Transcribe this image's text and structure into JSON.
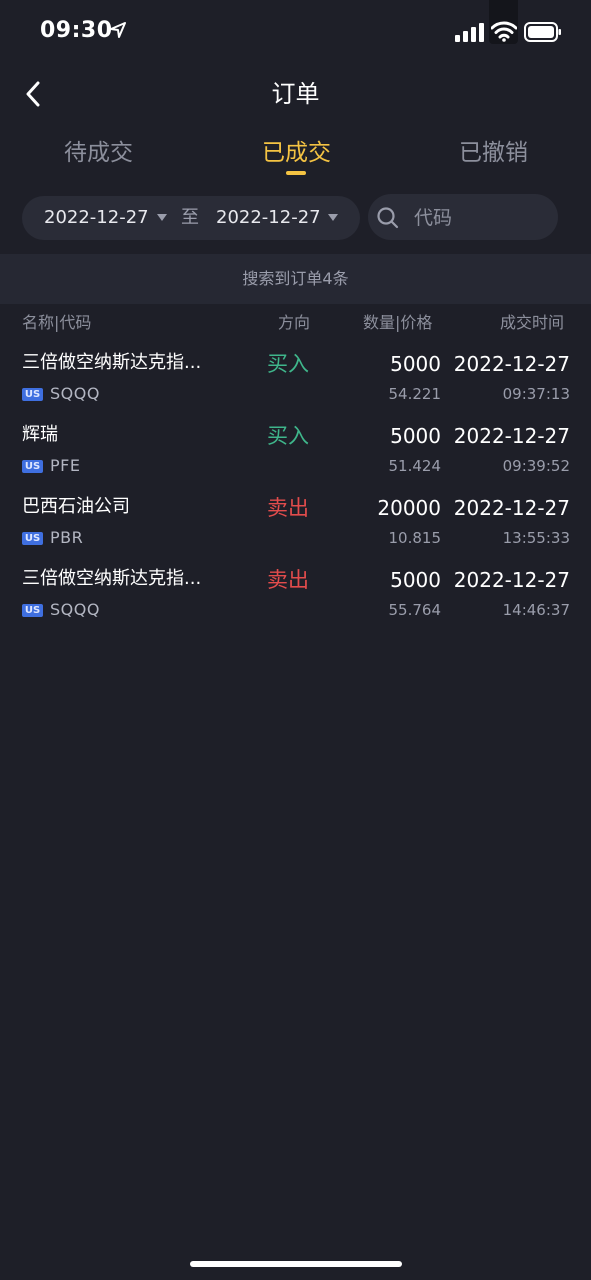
{
  "status_bar": {
    "time": "09:30",
    "icons": [
      "location-arrow-icon",
      "signal-icon",
      "wifi-icon",
      "battery-icon"
    ]
  },
  "header": {
    "title": "订单",
    "back_icon": "chevron-left-icon"
  },
  "tabs": [
    {
      "label": "待成交",
      "active": false
    },
    {
      "label": "已成交",
      "active": true
    },
    {
      "label": "已撤销",
      "active": false
    }
  ],
  "filter": {
    "start_date": "2022-12-27",
    "separator": "至",
    "end_date": "2022-12-27",
    "search_placeholder": "代码",
    "search_value": ""
  },
  "result_summary": "搜索到订单4条",
  "columns": {
    "name_code": "名称|代码",
    "direction": "方向",
    "qty_price": "数量|价格",
    "time": "成交时间"
  },
  "colors": {
    "background": "#1e1f28",
    "accent": "#f4c343",
    "buy": "#3fb68b",
    "sell": "#e24c4c",
    "market_badge": "#3f6fe0"
  },
  "orders": [
    {
      "name": "三倍做空纳斯达克指...",
      "market": "US",
      "code": "SQQQ",
      "direction": "买入",
      "side": "buy",
      "quantity": "5000",
      "price": "54.221",
      "date": "2022-12-27",
      "time": "09:37:13"
    },
    {
      "name": "辉瑞",
      "market": "US",
      "code": "PFE",
      "direction": "买入",
      "side": "buy",
      "quantity": "5000",
      "price": "51.424",
      "date": "2022-12-27",
      "time": "09:39:52"
    },
    {
      "name": "巴西石油公司",
      "market": "US",
      "code": "PBR",
      "direction": "卖出",
      "side": "sell",
      "quantity": "20000",
      "price": "10.815",
      "date": "2022-12-27",
      "time": "13:55:33"
    },
    {
      "name": "三倍做空纳斯达克指...",
      "market": "US",
      "code": "SQQQ",
      "direction": "卖出",
      "side": "sell",
      "quantity": "5000",
      "price": "55.764",
      "date": "2022-12-27",
      "time": "14:46:37"
    }
  ]
}
